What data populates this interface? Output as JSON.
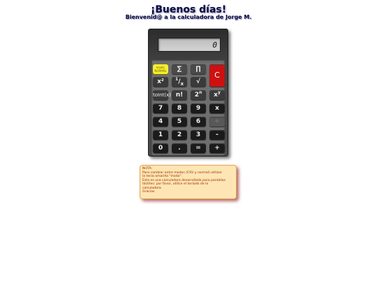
{
  "header": {
    "title": "¡Buenos días!",
    "subtitle": "Bienvenid@ a la calculadora de Jorge M."
  },
  "display": {
    "value": "0"
  },
  "keys": {
    "mode_line1": "modo:",
    "mode_line2": "NORMAL",
    "sum": "∑",
    "product": "∏",
    "clear": "C",
    "square": "x²",
    "reciprocal_num": "1",
    "reciprocal_sep": "/",
    "reciprocal_den": "x",
    "sqrt": "√",
    "toint": "toInt(x)",
    "factorial": "n!",
    "power2_base": "2",
    "power2_exp": "n",
    "powxy_base": "x",
    "powxy_exp": "y",
    "d7": "7",
    "d8": "8",
    "d9": "9",
    "multiply": "x",
    "d4": "4",
    "d5": "5",
    "d6": "6",
    "divide": "÷",
    "d1": "1",
    "d2": "2",
    "d3": "3",
    "minus": "-",
    "d0": "0",
    "dot": ".",
    "equals": "=",
    "plus": "+"
  },
  "note": {
    "line1": "NOTA:",
    "line2": "Para cambiar entre modos (CSV y normal) utilizar",
    "line3": "la tecla amarilla \"modo\".",
    "line4": "Esta es una calculadora desarrollada para pantallas",
    "line5": "táctiles: por favor, utilice el teclado de la",
    "line6": "calculadora.",
    "line7": "Gracias."
  },
  "colors": {
    "mode_key": "#f3ef2f",
    "clear_key": "#cf1010",
    "note_background": "#fde6b4",
    "note_text": "#a02a00",
    "title_text": "#0a0a40"
  }
}
